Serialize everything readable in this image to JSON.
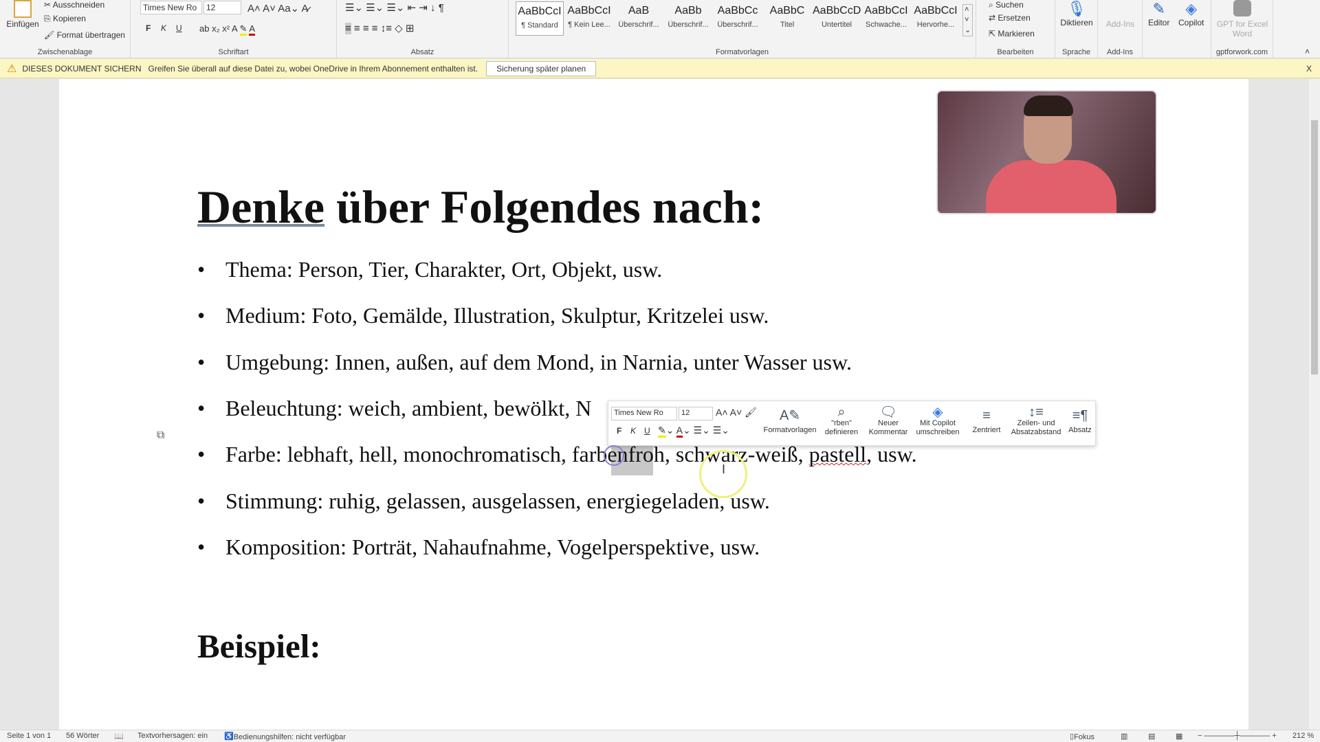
{
  "ribbon": {
    "clipboard": {
      "paste": "Einfügen",
      "cut": "Ausschneiden",
      "copy": "Kopieren",
      "format_painter": "Format übertragen",
      "label": "Zwischenablage"
    },
    "font": {
      "name": "Times New Ro",
      "size": "12",
      "bold": "F",
      "italic": "K",
      "underline": "U",
      "label": "Schriftart"
    },
    "paragraph": {
      "label": "Absatz"
    },
    "styles": {
      "label": "Formatvorlagen",
      "items": [
        {
          "preview": "AaBbCcI",
          "name": "¶ Standard"
        },
        {
          "preview": "AaBbCcI",
          "name": "¶ Kein Lee..."
        },
        {
          "preview": "AaB",
          "name": "Überschrif..."
        },
        {
          "preview": "AaBb",
          "name": "Überschrif..."
        },
        {
          "preview": "AaBbCc",
          "name": "Überschrif..."
        },
        {
          "preview": "AaBbC",
          "name": "Titel"
        },
        {
          "preview": "AaBbCcD",
          "name": "Untertitel"
        },
        {
          "preview": "AaBbCcI",
          "name": "Schwache..."
        },
        {
          "preview": "AaBbCcI",
          "name": "Hervorhe..."
        }
      ]
    },
    "editing": {
      "find": "Suchen",
      "replace": "Ersetzen",
      "select": "Markieren",
      "label": "Bearbeiten"
    },
    "voice": {
      "dictate": "Diktieren",
      "label": "Sprache"
    },
    "addins": {
      "addins": "Add-Ins",
      "label": "Add-Ins"
    },
    "editor": "Editor",
    "copilot": "Copilot",
    "gpt": {
      "button": "GPT for Excel Word",
      "label": "gptforwork.com"
    }
  },
  "notification": {
    "title": "DIESES DOKUMENT SICHERN",
    "message": "Greifen Sie überall auf diese Datei zu, wobei OneDrive in Ihrem Abonnement enthalten ist.",
    "button": "Sicherung später planen",
    "close": "X"
  },
  "document": {
    "heading_u": "Denke",
    "heading_rest": " über Folgendes nach:",
    "bullets": [
      "Thema: Person, Tier, Charakter, Ort, Objekt, usw.",
      "Medium: Foto, Gemälde, Illustration, Skulptur, Kritzelei usw.",
      "Umgebung: Innen, außen, auf dem Mond, in Narnia, unter Wasser usw.",
      "Beleuchtung: weich, ambient, bewölkt, N",
      "Farbe: lebhaft, hell, monochromatisch, farbenfroh, schwarz-weiß, ",
      "Stimmung: ruhig, gelassen, ausgelassen, energiegeladen, usw.",
      "Komposition: Porträt, Nahaufnahme, Vogelperspektive, usw."
    ],
    "bullet_5_spell": "pastell",
    "bullet_5_tail": ", usw.",
    "heading2": "Beispiel:"
  },
  "mini_toolbar": {
    "font": "Times New Ro",
    "size": "12",
    "bold": "F",
    "italic": "K",
    "underline": "U",
    "styles": "Formatvorlagen",
    "define": "\"rben\" definieren",
    "comment": "Neuer Kommentar",
    "copilot": "Mit Copilot umschreiben",
    "center": "Zentriert",
    "spacing": "Zeilen- und Absatzabstand",
    "paragraph": "Absatz"
  },
  "status": {
    "page": "Seite 1 von 1",
    "words": "56 Wörter",
    "prediction": "Textvorhersagen: ein",
    "accessibility": "Bedienungshilfen: nicht verfügbar",
    "focus": "Fokus",
    "zoom": "212 %"
  }
}
